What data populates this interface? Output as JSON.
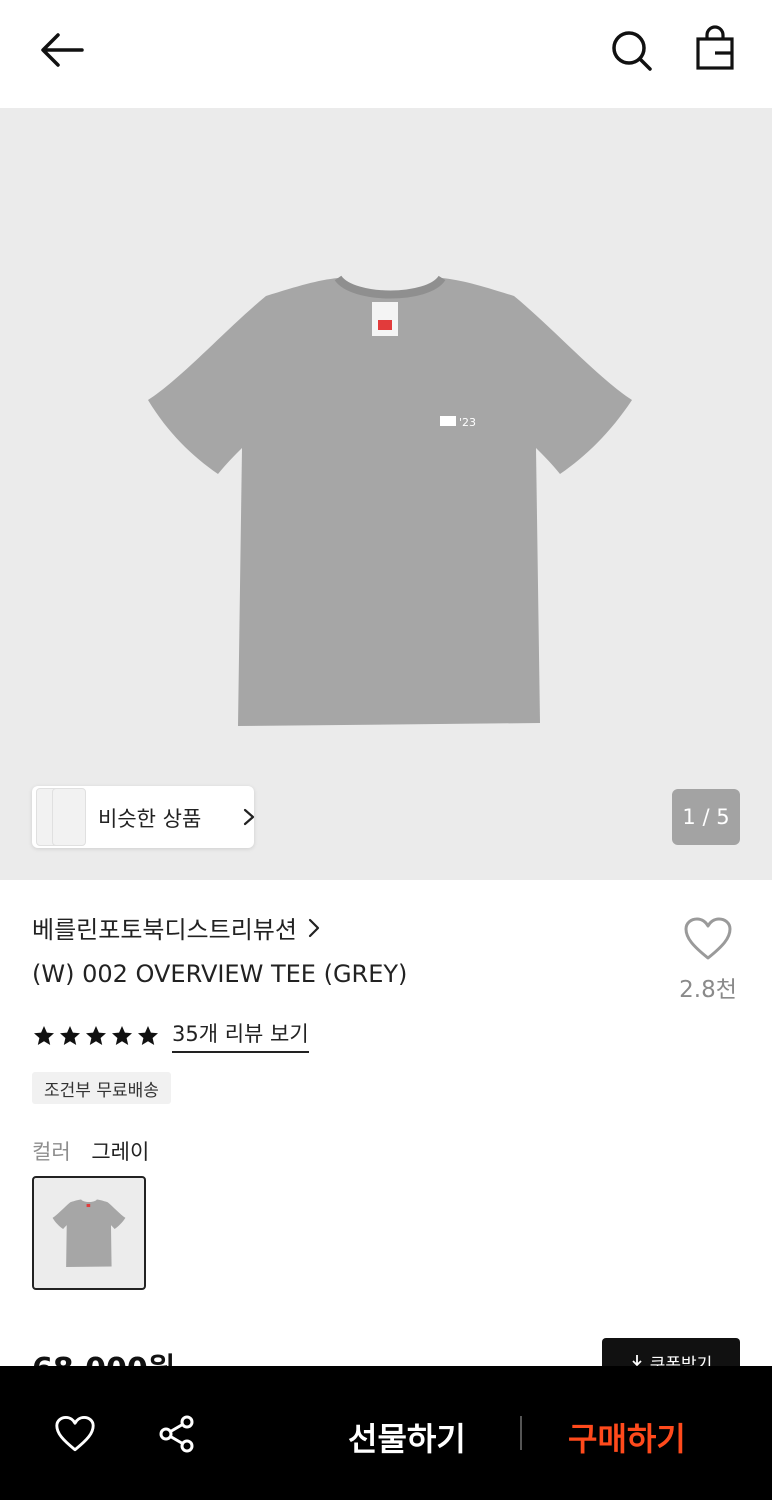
{
  "header": {
    "back_icon": "arrow-left-icon",
    "search_icon": "search-icon",
    "bag_icon": "shopping-bag-icon"
  },
  "gallery": {
    "similar_label": "비슷한 상품",
    "counter": "1 / 5"
  },
  "product": {
    "brand": "베를린포토북디스트리뷰션",
    "title": "(W) 002 OVERVIEW TEE (GREY)",
    "like_count": "2.8천",
    "rating_stars": 5,
    "review_link": "35개 리뷰 보기",
    "shipping_badge": "조건부 무료배송",
    "color_label": "컬러",
    "color_value": "그레이",
    "price": "68,000원",
    "coupon_label": "쿠폰받기"
  },
  "bottom_bar": {
    "gift_label": "선물하기",
    "buy_label": "구매하기",
    "buy_color": "#ff4a1c"
  }
}
